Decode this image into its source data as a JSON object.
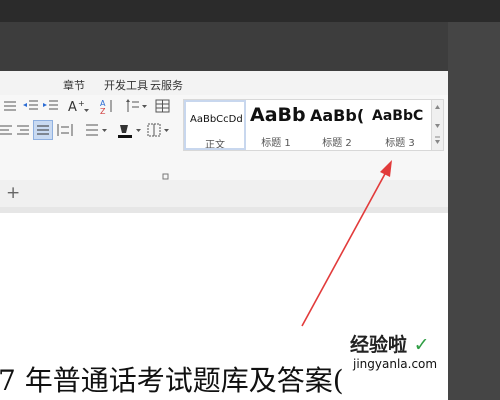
{
  "menu": {
    "items": [
      "章节",
      "开发工具",
      "云服务"
    ]
  },
  "styles": {
    "cards": [
      {
        "preview": "AaBbCcDd",
        "label": "正文"
      },
      {
        "preview": "AaBb",
        "label": "标题 1"
      },
      {
        "preview": "AaBb(",
        "label": "标题 2"
      },
      {
        "preview": "AaBbC",
        "label": "标题 3"
      }
    ]
  },
  "tabbar": {
    "add_label": "+"
  },
  "document": {
    "title_line": "7 年普通话考试题库及答案(",
    "watermark_main": "经验啦",
    "watermark_check": "✓",
    "watermark_url": "jingyanla.com"
  },
  "colors": {
    "arrow": "#e23b3b",
    "accent": "#2b6cd4"
  }
}
